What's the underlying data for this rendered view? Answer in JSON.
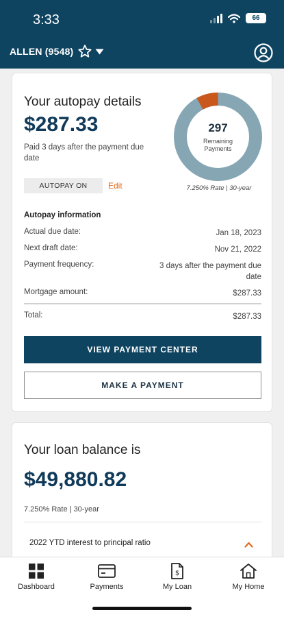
{
  "status_bar": {
    "time": "3:33",
    "battery": "66"
  },
  "header": {
    "account_name": "ALLEN (9548)"
  },
  "autopay": {
    "title": "Your autopay details",
    "amount": "$287.33",
    "description": "Paid 3 days after the payment due date",
    "badge": "AUTOPAY ON",
    "edit_label": "Edit",
    "remaining_payments": "297",
    "remaining_label": "Remaining Payments",
    "rate_caption": "7.250% Rate | 30-year",
    "remaining_fraction": 0.92,
    "colors": {
      "remaining": "#87a6b4",
      "paid": "#c9581c"
    }
  },
  "autopay_info": {
    "heading": "Autopay information",
    "rows": [
      {
        "label": "Actual due date:",
        "value": "Jan 18, 2023"
      },
      {
        "label": "Next draft date:",
        "value": "Nov 21, 2022"
      },
      {
        "label": "Payment frequency:",
        "value": "3 days after the payment due date"
      },
      {
        "label": "Mortgage amount:",
        "value": "$287.33"
      },
      {
        "label": "Total:",
        "value": "$287.33"
      }
    ]
  },
  "buttons": {
    "view_payment_center": "VIEW PAYMENT CENTER",
    "make_payment": "MAKE A PAYMENT"
  },
  "loan": {
    "title": "Your loan balance is",
    "amount": "$49,880.82",
    "rate": "7.250% Rate | 30-year",
    "ratio_label": "2022 YTD interest to principal ratio"
  },
  "nav": {
    "items": [
      {
        "label": "Dashboard",
        "icon": "dashboard-icon"
      },
      {
        "label": "Payments",
        "icon": "payments-card-icon"
      },
      {
        "label": "My Loan",
        "icon": "loan-document-icon"
      },
      {
        "label": "My Home",
        "icon": "home-icon"
      }
    ]
  },
  "colors": {
    "brand": "#0e4460",
    "accent": "#e06a1b"
  }
}
